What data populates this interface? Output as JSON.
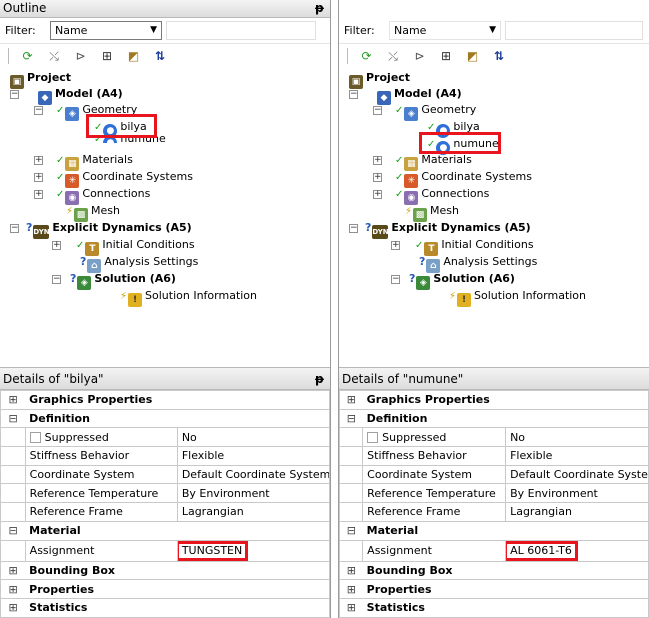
{
  "left": {
    "outline_title": "Outline",
    "pin_glyph": "ᵽ",
    "filter_label": "Filter:",
    "filter_value": "Name",
    "tree": {
      "project": "Project",
      "model": "Model (A4)",
      "geometry": "Geometry",
      "body1": "bilya",
      "body2": "numune",
      "materials": "Materials",
      "coordinate_systems": "Coordinate Systems",
      "connections": "Connections",
      "mesh": "Mesh",
      "explicit_dynamics": "Explicit Dynamics (A5)",
      "initial_conditions": "Initial Conditions",
      "analysis_settings": "Analysis Settings",
      "solution": "Solution (A6)",
      "solution_information": "Solution Information"
    },
    "details_title": "Details of \"bilya\"",
    "details": {
      "graphics_properties": "Graphics Properties",
      "definition": "Definition",
      "suppressed_label": "Suppressed",
      "suppressed_value": "No",
      "stiffness_label": "Stiffness Behavior",
      "stiffness_value": "Flexible",
      "coord_label": "Coordinate System",
      "coord_value": "Default Coordinate System",
      "reftemp_label": "Reference Temperature",
      "reftemp_value": "By Environment",
      "refframe_label": "Reference Frame",
      "refframe_value": "Lagrangian",
      "material": "Material",
      "assignment_label": "Assignment",
      "assignment_value": "TUNGSTEN",
      "bounding_box": "Bounding Box",
      "properties": "Properties",
      "statistics": "Statistics"
    }
  },
  "right": {
    "filter_label": "Filter:",
    "filter_value": "Name",
    "tree": {
      "project": "Project",
      "model": "Model (A4)",
      "geometry": "Geometry",
      "body1": "bilya",
      "body2": "numune",
      "materials": "Materials",
      "coordinate_systems": "Coordinate Systems",
      "connections": "Connections",
      "mesh": "Mesh",
      "explicit_dynamics": "Explicit Dynamics (A5)",
      "initial_conditions": "Initial Conditions",
      "analysis_settings": "Analysis Settings",
      "solution": "Solution (A6)",
      "solution_information": "Solution Information"
    },
    "details_title": "Details of \"numune\"",
    "details": {
      "graphics_properties": "Graphics Properties",
      "definition": "Definition",
      "suppressed_label": "Suppressed",
      "suppressed_value": "No",
      "stiffness_label": "Stiffness Behavior",
      "stiffness_value": "Flexible",
      "coord_label": "Coordinate System",
      "coord_value": "Default Coordinate System",
      "reftemp_label": "Reference Temperature",
      "reftemp_value": "By Environment",
      "refframe_label": "Reference Frame",
      "refframe_value": "Lagrangian",
      "material": "Material",
      "assignment_label": "Assignment",
      "assignment_value": "AL 6061-T6",
      "bounding_box": "Bounding Box",
      "properties": "Properties",
      "statistics": "Statistics"
    }
  },
  "icons": {
    "refresh": "refresh-icon",
    "tree": "tree-icon",
    "dim": "dimension-icon",
    "expand_all": "expand-all-icon",
    "body_sel": "body-select-icon",
    "sort": "sort-az-icon"
  },
  "colors": {
    "highlight": "#e8141e",
    "ok_check": "#1aa01a",
    "question": "#2a5ab8"
  }
}
